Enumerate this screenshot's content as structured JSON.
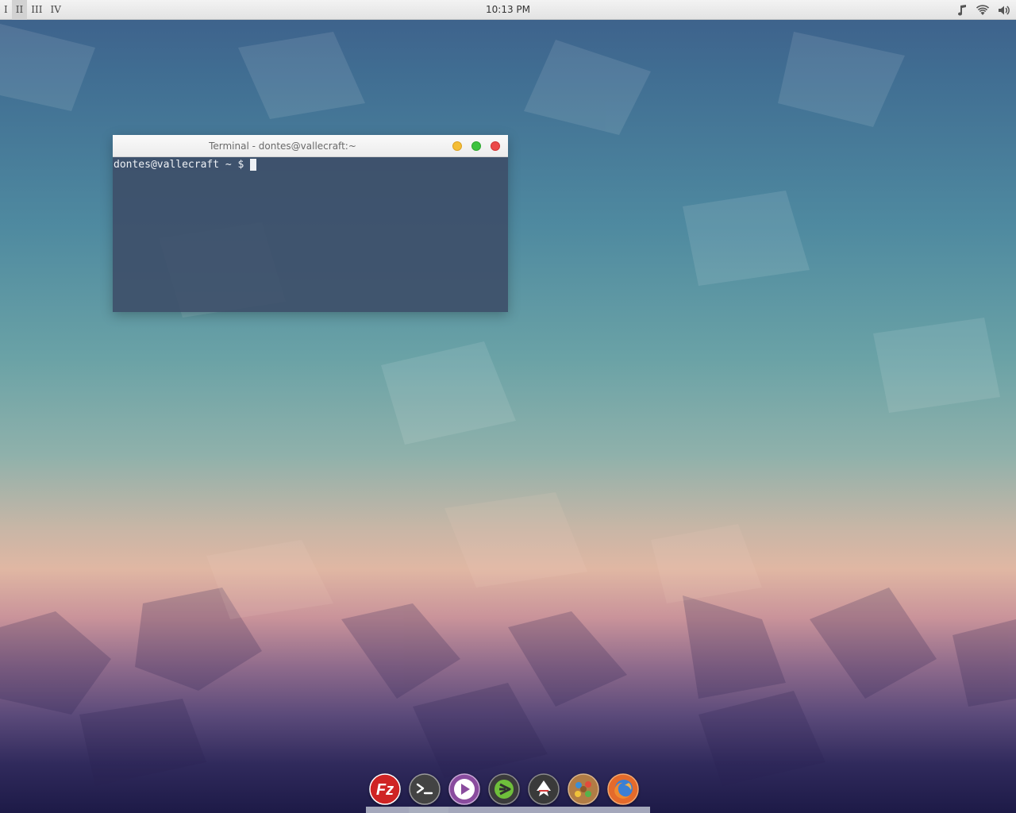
{
  "panel": {
    "workspaces": [
      {
        "label": "I"
      },
      {
        "label": "II",
        "active": true
      },
      {
        "label": "III"
      },
      {
        "label": "IV"
      }
    ],
    "clock": "10:13 PM",
    "tray": [
      "music-note-icon",
      "wifi-icon",
      "volume-icon"
    ]
  },
  "terminal": {
    "title": "Terminal - dontes@vallecraft:~",
    "prompt": "dontes@vallecraft ~ $",
    "buttons": {
      "minimize": "#f4bd35",
      "maximize": "#3dc33f",
      "close": "#eb4a4a"
    }
  },
  "dock": {
    "items": [
      {
        "name": "filezilla-icon",
        "color": "#d32b2b"
      },
      {
        "name": "terminal-icon",
        "color": "#454545"
      },
      {
        "name": "media-player-icon",
        "color": "#8d4fa0"
      },
      {
        "name": "sublime-text-icon",
        "color": "#3b3b3b"
      },
      {
        "name": "inkscape-icon",
        "color": "#3a3a3a"
      },
      {
        "name": "gimp-icon",
        "color": "#b07d48"
      },
      {
        "name": "firefox-icon",
        "color": "#e46a2b"
      }
    ]
  }
}
